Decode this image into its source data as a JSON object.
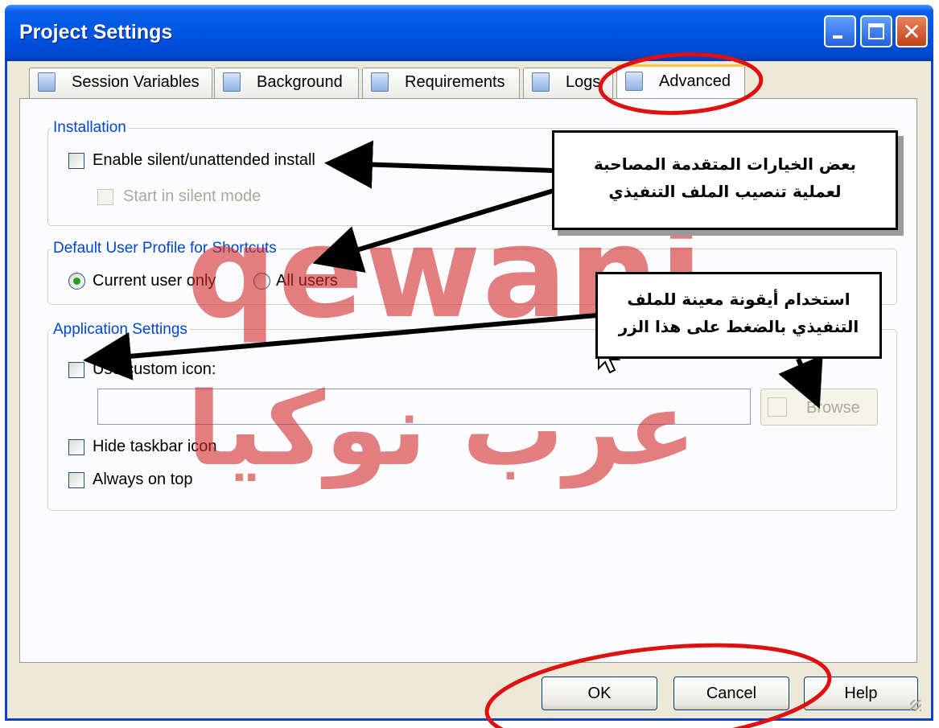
{
  "window": {
    "title": "Project Settings"
  },
  "tabs": [
    {
      "label": "Session Variables"
    },
    {
      "label": "Background"
    },
    {
      "label": "Requirements"
    },
    {
      "label": "Logs"
    },
    {
      "label": "Advanced",
      "active": true
    }
  ],
  "installation": {
    "group_label": "Installation",
    "silent_install": {
      "label": "Enable silent/unattended install",
      "checked": false
    },
    "silent_mode": {
      "label": "Start in silent mode",
      "checked": false,
      "enabled": false
    }
  },
  "profile": {
    "group_label": "Default User Profile for Shortcuts",
    "options": [
      {
        "label": "Current user only",
        "selected": true
      },
      {
        "label": "All users",
        "selected": false
      }
    ]
  },
  "app_settings": {
    "group_label": "Application Settings",
    "custom_icon": {
      "label": "Use custom icon:",
      "checked": false
    },
    "icon_path": "",
    "browse_label": "Browse",
    "hide_taskbar": {
      "label": "Hide taskbar icon",
      "checked": false
    },
    "always_on_top": {
      "label": "Always on top",
      "checked": false
    }
  },
  "buttons": {
    "ok": "OK",
    "cancel": "Cancel",
    "help": "Help"
  },
  "annotations": {
    "note1": [
      "بعض الخيارات المتقدمة المصاحبة",
      "لعملية تنصيب الملف التنفيذي"
    ],
    "note2": [
      "استخدام أيقونة معينة للملف",
      "التنفيذي بالضغط على هذا الزر"
    ]
  },
  "watermark": {
    "latin": "qewani",
    "arabic": "عرب نوكيا"
  },
  "colors": {
    "titlebar": "#0055e5",
    "group_label": "#0046d5",
    "highlight_ellipse": "#e01010",
    "radio_dot": "#21a121"
  }
}
